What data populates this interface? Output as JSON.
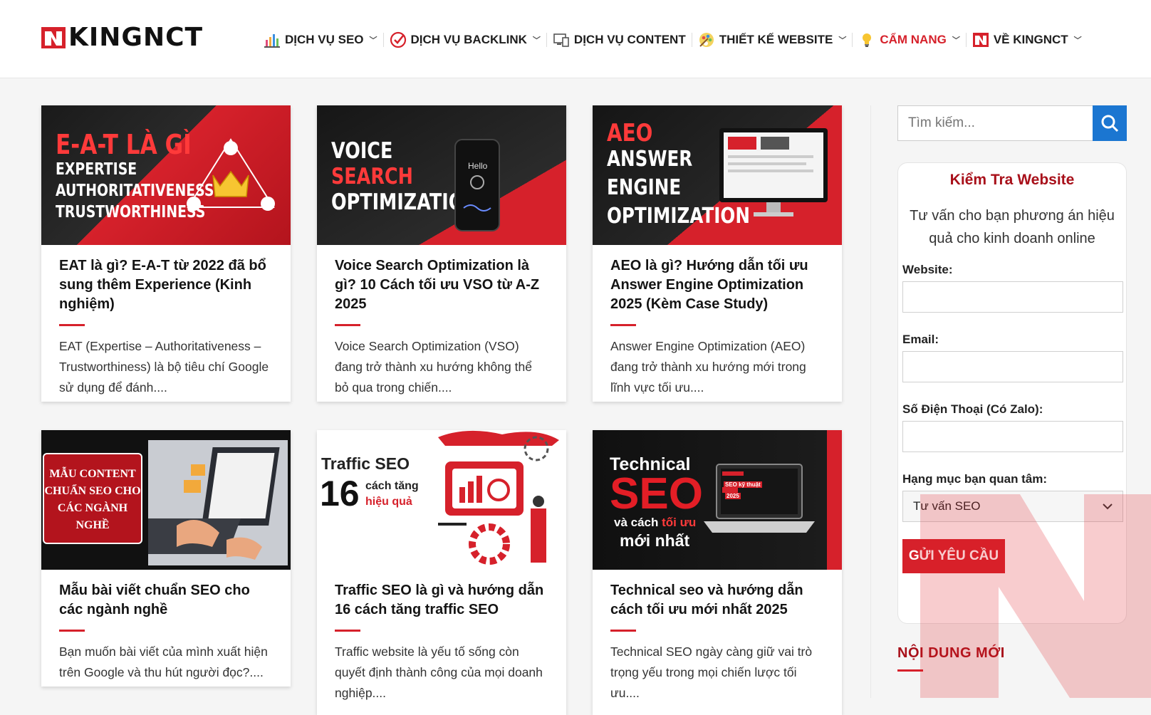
{
  "brand": {
    "name": "KINGNCT",
    "accent": "#d6212b",
    "dark_red": "#a8101a",
    "link_blue": "#1b76d1"
  },
  "nav": [
    {
      "label": "DỊCH VỤ SEO",
      "icon": "seo-chart-icon",
      "dropdown": true,
      "active": false
    },
    {
      "label": "DỊCH VỤ BACKLINK",
      "icon": "checkmark-badge-icon",
      "dropdown": true,
      "active": false
    },
    {
      "label": "DỊCH VỤ CONTENT",
      "icon": "devices-icon",
      "dropdown": false,
      "active": false
    },
    {
      "label": "THIẾT KẾ WEBSITE",
      "icon": "palette-icon",
      "dropdown": true,
      "active": false
    },
    {
      "label": "CẨM NANG",
      "icon": "lightbulb-icon",
      "dropdown": true,
      "active": true
    },
    {
      "label": "VỀ KINGNCT",
      "icon": "kingnct-logo-icon",
      "dropdown": true,
      "active": false
    }
  ],
  "posts": [
    {
      "title": "EAT là gì? E-A-T từ 2022 đã bổ sung thêm Experience (Kinh nghiệm)",
      "excerpt": "EAT (Expertise – Authoritativeness – Trustworthiness) là bộ tiêu chí Google sử dụng để đánh....",
      "thumb": {
        "l1": "E-A-T LÀ GÌ",
        "l2": "EXPERTISE",
        "l3": "AUTHORITATIVENESS",
        "l4": "TRUSTWORTHINESS"
      }
    },
    {
      "title": "Voice Search Optimization là gì? 10 Cách tối ưu VSO từ A-Z 2025",
      "excerpt": "Voice Search Optimization (VSO) đang trở thành xu hướng không thể bỏ qua trong chiến....",
      "thumb": {
        "l1": "VOICE",
        "l2": "SEARCH",
        "l3": "OPTIMIZATION",
        "phone": "Hello"
      }
    },
    {
      "title": "AEO là gì? Hướng dẫn tối ưu Answer Engine Optimization 2025 (Kèm Case Study)",
      "excerpt": "Answer Engine Optimization (AEO) đang trở thành xu hướng mới trong lĩnh vực tối ưu....",
      "thumb": {
        "l1": "AEO",
        "l2": "ANSWER",
        "l3": "ENGINE",
        "l4": "OPTIMIZATION"
      }
    },
    {
      "title": "Mẫu bài viết chuẩn SEO cho các ngành nghề",
      "excerpt": "Bạn muốn bài viết của mình xuất hiện trên Google và thu hút người đọc?....",
      "thumb": {
        "l1": "MẪU CONTENT",
        "l2": "CHUẨN SEO CHO",
        "l3": "CÁC NGÀNH",
        "l4": "NGHỀ"
      }
    },
    {
      "title": "Traffic SEO là gì và hướng dẫn 16 cách tăng traffic SEO",
      "excerpt": "Traffic website là yếu tố sống còn quyết định thành công của mọi doanh nghiệp....",
      "thumb": {
        "l1": "Traffic SEO",
        "l2": "16",
        "l3": "cách tăng",
        "l4": "hiệu quả"
      }
    },
    {
      "title": "Technical seo và hướng dẫn cách tối ưu mới nhất 2025",
      "excerpt": "Technical SEO ngày càng giữ vai trò trọng yếu trong mọi chiến lược tối ưu....",
      "thumb": {
        "l1": "Technical",
        "l2": "SEO",
        "l3": "và cách",
        "l3b": "tối ưu",
        "l4": "mới nhất",
        "screen_tag": "SEO kỹ thuật",
        "screen_year": "2025"
      }
    }
  ],
  "search": {
    "placeholder": "Tìm kiếm..."
  },
  "form": {
    "title": "Kiểm Tra Website",
    "subtitle": "Tư vấn cho bạn phương án hiệu quả cho kinh doanh online",
    "website_label": "Website:",
    "email_label": "Email:",
    "phone_label": "Số Điện Thoại (Có Zalo):",
    "category_label": "Hạng mục bạn quan tâm:",
    "category_value": "Tư vấn SEO",
    "submit_label": "GỬI YÊU CẦU"
  },
  "sidebar": {
    "newest_heading": "NỘI DUNG MỚI"
  }
}
